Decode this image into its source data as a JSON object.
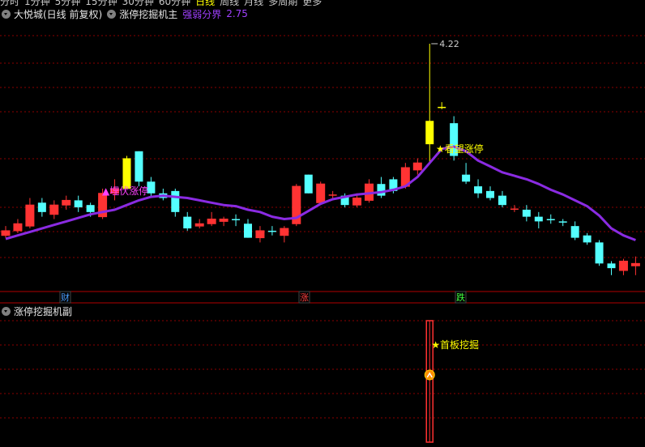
{
  "toolbar": {
    "items": [
      "分时",
      "1分钟",
      "5分钟",
      "15分钟",
      "30分钟",
      "60分钟",
      "日线",
      "周线",
      "月线",
      "多周期",
      "更多"
    ],
    "active": "日线"
  },
  "header": {
    "stock_name": "大悦城(日线 前复权)",
    "indicator_name": "涨停挖掘机主",
    "param_label": "强弱分界",
    "param_value": "2.75"
  },
  "main_chart": {
    "max_price_label": "4.22",
    "annotations": [
      {
        "text": "▲埋伏涨停",
        "color": "#ff40ff"
      },
      {
        "text": "★看望涨停",
        "color": "#ffff00"
      }
    ],
    "bottom_markers": [
      {
        "text": "财",
        "color": "#4aa0ff"
      },
      {
        "text": "涨",
        "color": "#ff4040"
      },
      {
        "text": "跌",
        "color": "#40ff40"
      }
    ]
  },
  "sub_header": {
    "indicator_name": "涨停挖掘机副"
  },
  "sub_chart": {
    "annotation": {
      "text": "★首板挖掘",
      "color": "#ffff00"
    }
  },
  "colors": {
    "up": "#ff3333",
    "down": "#54ffff",
    "limit_up": "#ffff00",
    "ma_line": "#8a2be2",
    "grid": "#8b0000",
    "sep": "#b00000"
  },
  "chart_data": {
    "type": "candlestick",
    "series_name": "",
    "candles": [
      {
        "o": 2.58,
        "c": 2.62,
        "h": 2.66,
        "l": 2.56,
        "t": "up"
      },
      {
        "o": 2.62,
        "c": 2.68,
        "h": 2.72,
        "l": 2.6,
        "t": "up"
      },
      {
        "o": 2.66,
        "c": 2.84,
        "h": 2.9,
        "l": 2.64,
        "t": "up"
      },
      {
        "o": 2.86,
        "c": 2.78,
        "h": 2.9,
        "l": 2.74,
        "t": "down"
      },
      {
        "o": 2.76,
        "c": 2.84,
        "h": 2.88,
        "l": 2.72,
        "t": "up"
      },
      {
        "o": 2.84,
        "c": 2.88,
        "h": 2.92,
        "l": 2.8,
        "t": "up"
      },
      {
        "o": 2.88,
        "c": 2.82,
        "h": 2.92,
        "l": 2.78,
        "t": "down"
      },
      {
        "o": 2.84,
        "c": 2.78,
        "h": 2.86,
        "l": 2.74,
        "t": "down"
      },
      {
        "o": 2.74,
        "c": 2.94,
        "h": 2.98,
        "l": 2.72,
        "t": "up"
      },
      {
        "o": 2.94,
        "c": 2.98,
        "h": 3.06,
        "l": 2.88,
        "t": "up"
      },
      {
        "o": 2.98,
        "c": 3.24,
        "h": 3.26,
        "l": 2.98,
        "t": "limit"
      },
      {
        "o": 3.3,
        "c": 3.04,
        "h": 3.3,
        "l": 3.0,
        "t": "down"
      },
      {
        "o": 3.04,
        "c": 2.94,
        "h": 3.08,
        "l": 2.9,
        "t": "down"
      },
      {
        "o": 2.94,
        "c": 2.9,
        "h": 2.98,
        "l": 2.88,
        "t": "down"
      },
      {
        "o": 2.96,
        "c": 2.78,
        "h": 2.98,
        "l": 2.74,
        "t": "down"
      },
      {
        "o": 2.74,
        "c": 2.64,
        "h": 2.78,
        "l": 2.62,
        "t": "down"
      },
      {
        "o": 2.66,
        "c": 2.68,
        "h": 2.72,
        "l": 2.64,
        "t": "up"
      },
      {
        "o": 2.68,
        "c": 2.72,
        "h": 2.78,
        "l": 2.66,
        "t": "up"
      },
      {
        "o": 2.7,
        "c": 2.72,
        "h": 2.74,
        "l": 2.66,
        "t": "up"
      },
      {
        "o": 2.72,
        "c": 2.71,
        "h": 2.76,
        "l": 2.66,
        "t": "doji"
      },
      {
        "o": 2.68,
        "c": 2.56,
        "h": 2.72,
        "l": 2.56,
        "t": "down"
      },
      {
        "o": 2.56,
        "c": 2.62,
        "h": 2.66,
        "l": 2.52,
        "t": "up"
      },
      {
        "o": 2.62,
        "c": 2.61,
        "h": 2.66,
        "l": 2.58,
        "t": "doji"
      },
      {
        "o": 2.58,
        "c": 2.64,
        "h": 2.66,
        "l": 2.52,
        "t": "up"
      },
      {
        "o": 2.68,
        "c": 3.0,
        "h": 3.02,
        "l": 2.66,
        "t": "up"
      },
      {
        "o": 3.1,
        "c": 2.94,
        "h": 3.1,
        "l": 2.94,
        "t": "down"
      },
      {
        "o": 2.86,
        "c": 3.02,
        "h": 3.04,
        "l": 2.84,
        "t": "up"
      },
      {
        "o": 2.92,
        "c": 2.93,
        "h": 2.96,
        "l": 2.88,
        "t": "doji"
      },
      {
        "o": 2.92,
        "c": 2.84,
        "h": 2.94,
        "l": 2.82,
        "t": "down"
      },
      {
        "o": 2.84,
        "c": 2.9,
        "h": 2.94,
        "l": 2.82,
        "t": "up"
      },
      {
        "o": 2.88,
        "c": 3.02,
        "h": 3.06,
        "l": 2.86,
        "t": "up"
      },
      {
        "o": 3.02,
        "c": 2.92,
        "h": 3.08,
        "l": 2.9,
        "t": "down"
      },
      {
        "o": 3.06,
        "c": 2.96,
        "h": 3.08,
        "l": 2.94,
        "t": "down"
      },
      {
        "o": 3.0,
        "c": 3.16,
        "h": 3.2,
        "l": 2.98,
        "t": "up"
      },
      {
        "o": 3.14,
        "c": 3.2,
        "h": 3.24,
        "l": 3.1,
        "t": "up"
      },
      {
        "o": 3.36,
        "c": 3.56,
        "h": 4.22,
        "l": 3.2,
        "t": "limit"
      },
      {
        "o": 3.68,
        "c": 3.68,
        "h": 3.72,
        "l": 3.66,
        "t": "flat"
      },
      {
        "o": 3.54,
        "c": 3.26,
        "h": 3.6,
        "l": 3.22,
        "t": "down"
      },
      {
        "o": 3.1,
        "c": 3.04,
        "h": 3.2,
        "l": 3.02,
        "t": "down"
      },
      {
        "o": 3.0,
        "c": 2.94,
        "h": 3.06,
        "l": 2.9,
        "t": "down"
      },
      {
        "o": 2.96,
        "c": 2.9,
        "h": 3.0,
        "l": 2.88,
        "t": "down"
      },
      {
        "o": 2.92,
        "c": 2.84,
        "h": 2.96,
        "l": 2.82,
        "t": "down"
      },
      {
        "o": 2.8,
        "c": 2.81,
        "h": 2.84,
        "l": 2.78,
        "t": "doji"
      },
      {
        "o": 2.8,
        "c": 2.74,
        "h": 2.84,
        "l": 2.7,
        "t": "down"
      },
      {
        "o": 2.74,
        "c": 2.7,
        "h": 2.78,
        "l": 2.64,
        "t": "down"
      },
      {
        "o": 2.72,
        "c": 2.71,
        "h": 2.76,
        "l": 2.68,
        "t": "doji"
      },
      {
        "o": 2.7,
        "c": 2.69,
        "h": 2.72,
        "l": 2.66,
        "t": "doji"
      },
      {
        "o": 2.66,
        "c": 2.56,
        "h": 2.7,
        "l": 2.54,
        "t": "down"
      },
      {
        "o": 2.58,
        "c": 2.52,
        "h": 2.6,
        "l": 2.5,
        "t": "down"
      },
      {
        "o": 2.52,
        "c": 2.34,
        "h": 2.54,
        "l": 2.32,
        "t": "down"
      },
      {
        "o": 2.34,
        "c": 2.3,
        "h": 2.36,
        "l": 2.24,
        "t": "down"
      },
      {
        "o": 2.28,
        "c": 2.36,
        "h": 2.38,
        "l": 2.24,
        "t": "up"
      },
      {
        "o": 2.32,
        "c": 2.34,
        "h": 2.4,
        "l": 2.24,
        "t": "up"
      }
    ],
    "ma": [
      2.55,
      2.58,
      2.61,
      2.64,
      2.67,
      2.7,
      2.73,
      2.76,
      2.78,
      2.8,
      2.84,
      2.88,
      2.91,
      2.92,
      2.91,
      2.9,
      2.88,
      2.86,
      2.84,
      2.83,
      2.8,
      2.78,
      2.74,
      2.72,
      2.73,
      2.79,
      2.85,
      2.89,
      2.91,
      2.93,
      2.94,
      2.95,
      2.97,
      3.0,
      3.08,
      3.2,
      3.32,
      3.34,
      3.3,
      3.22,
      3.17,
      3.12,
      3.09,
      3.06,
      3.02,
      2.97,
      2.93,
      2.88,
      2.83,
      2.75,
      2.64,
      2.58,
      2.54
    ]
  }
}
